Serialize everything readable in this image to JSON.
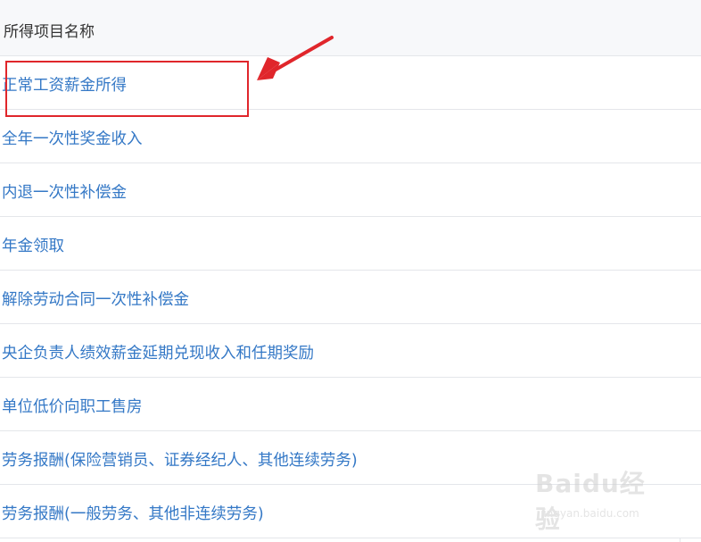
{
  "table": {
    "header": "所得项目名称",
    "rows": [
      {
        "label": "正常工资薪金所得"
      },
      {
        "label": "全年一次性奖金收入"
      },
      {
        "label": "内退一次性补偿金"
      },
      {
        "label": "年金领取"
      },
      {
        "label": "解除劳动合同一次性补偿金"
      },
      {
        "label": "央企负责人绩效薪金延期兑现收入和任期奖励"
      },
      {
        "label": "单位低价向职工售房"
      },
      {
        "label": "劳务报酬(保险营销员、证券经纪人、其他连续劳务)"
      },
      {
        "label": "劳务报酬(一般劳务、其他非连续劳务)"
      }
    ]
  },
  "annotation": {
    "box_color": "#e0262b",
    "arrow_color": "#e0262b"
  },
  "watermark": {
    "logo": "Baidu经验",
    "url": "jingyan.baidu.com"
  },
  "colors": {
    "link": "#3478c6",
    "header_bg": "#f7f8fa",
    "border": "#e4e6ea"
  }
}
